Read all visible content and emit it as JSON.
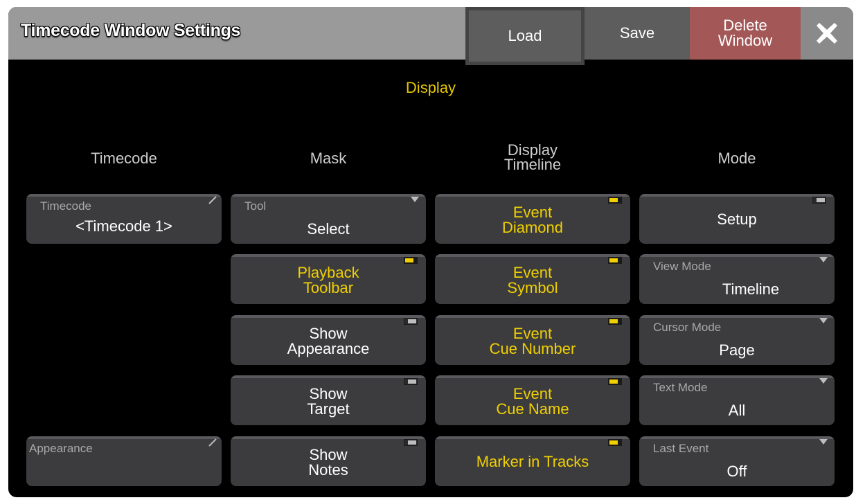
{
  "window": {
    "title": "Timecode Window Settings"
  },
  "toolbar": {
    "load_label": "Load",
    "save_label": "Save",
    "delete_label_line1": "Delete",
    "delete_label_line2": "Window",
    "close_icon": "close-x-icon"
  },
  "section": {
    "title": "Display"
  },
  "columns": {
    "timecode": "Timecode",
    "mask": "Mask",
    "display_timeline_line1": "Display",
    "display_timeline_line2": "Timeline",
    "mode": "Mode"
  },
  "timecode_col": {
    "timecode_label": "Timecode",
    "timecode_value": "<Timecode 1>",
    "appearance_label": "Appearance",
    "appearance_value": ""
  },
  "mask_col": {
    "tool_label": "Tool",
    "tool_value": "Select",
    "playback_toolbar": {
      "line1": "Playback",
      "line2": "Toolbar",
      "on": true
    },
    "show_appearance": {
      "line1": "Show",
      "line2": "Appearance",
      "on": false
    },
    "show_target": {
      "line1": "Show",
      "line2": "Target",
      "on": false
    },
    "show_notes": {
      "line1": "Show",
      "line2": "Notes",
      "on": false
    }
  },
  "timeline_col": {
    "event_diamond": {
      "line1": "Event",
      "line2": "Diamond",
      "on": true
    },
    "event_symbol": {
      "line1": "Event",
      "line2": "Symbol",
      "on": true
    },
    "event_cue_number": {
      "line1": "Event",
      "line2": "Cue Number",
      "on": true
    },
    "event_cue_name": {
      "line1": "Event",
      "line2": "Cue Name",
      "on": true
    },
    "marker_in_tracks": {
      "label": "Marker in Tracks",
      "on": true
    }
  },
  "mode_col": {
    "setup": {
      "label": "Setup",
      "on": false
    },
    "view_mode": {
      "label": "View Mode",
      "value": "Timeline"
    },
    "cursor_mode": {
      "label": "Cursor Mode",
      "value": "Page"
    },
    "text_mode": {
      "label": "Text Mode",
      "value": "All"
    },
    "last_event": {
      "label": "Last Event",
      "value": "Off"
    }
  },
  "colors": {
    "accent_yellow": "#f0d000",
    "delete_red": "#a35757",
    "button_bg": "#3c3c3f",
    "titlebar_bg": "#9a9a9a"
  }
}
